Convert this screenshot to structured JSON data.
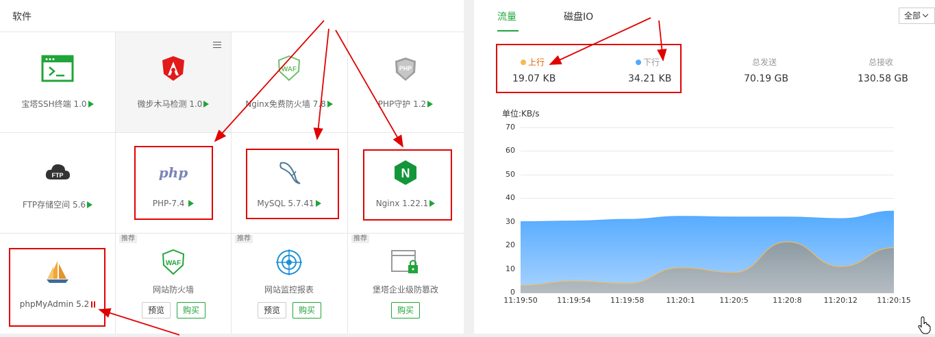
{
  "software": {
    "title": "软件",
    "items": [
      {
        "label": "宝塔SSH终端 1.0",
        "icon": "terminal-icon"
      },
      {
        "label": "微步木马检测 1.0",
        "icon": "shield-red-icon"
      },
      {
        "label": "Nginx免费防火墙 7.8",
        "icon": "waf-icon"
      },
      {
        "label": "PHP守护 1.2",
        "icon": "php-shield-icon"
      },
      {
        "label": "FTP存储空间 5.6",
        "icon": "ftp-cloud-icon"
      },
      {
        "label": "PHP-7.4",
        "icon": "php-icon",
        "logo_text": "php"
      },
      {
        "label": "MySQL 5.7.41",
        "icon": "mysql-dolphin-icon"
      },
      {
        "label": "Nginx 1.22.1",
        "icon": "nginx-icon",
        "logo_text": "N"
      },
      {
        "label": "phpMyAdmin 5.2",
        "icon": "sailboat-icon"
      },
      {
        "label": "网站防火墙",
        "icon": "waf-icon",
        "badge": "推荐",
        "preview": "预览",
        "buy": "购买"
      },
      {
        "label": "网站监控报表",
        "icon": "target-icon",
        "badge": "推荐",
        "preview": "预览",
        "buy": "购买"
      },
      {
        "label": "堡塔企业级防篡改",
        "icon": "lock-window-icon",
        "badge": "推荐",
        "buy": "购买"
      }
    ],
    "menu_icon": "hamburger-icon"
  },
  "network": {
    "tabs": [
      "流量",
      "磁盘IO"
    ],
    "active_tab": 0,
    "select": "全部",
    "stats": [
      {
        "label": "上行",
        "value": "19.07 KB",
        "color": "#f7b851"
      },
      {
        "label": "下行",
        "value": "34.21 KB",
        "color": "#52a9ff"
      },
      {
        "label": "总发送",
        "value": "70.19 GB"
      },
      {
        "label": "总接收",
        "value": "130.58 GB"
      }
    ],
    "unit": "单位:KB/s"
  },
  "chart_data": {
    "type": "area",
    "x": [
      "11:19:50",
      "11:19:54",
      "11:19:58",
      "11:20:1",
      "11:20:5",
      "11:20:8",
      "11:20:12",
      "11:20:15"
    ],
    "ylim": [
      0,
      70
    ],
    "yticks": [
      0,
      10,
      20,
      30,
      40,
      50,
      60,
      70
    ],
    "grid": true,
    "series": [
      {
        "name": "下行",
        "color": "#52a9ff",
        "values": [
          30,
          30.3,
          31,
          32.3,
          32,
          32,
          31.3,
          34.5
        ]
      },
      {
        "name": "上行",
        "color": "#f7b851",
        "values": [
          3,
          4.8,
          3.8,
          10.5,
          8.5,
          21.5,
          11,
          19
        ]
      }
    ]
  }
}
